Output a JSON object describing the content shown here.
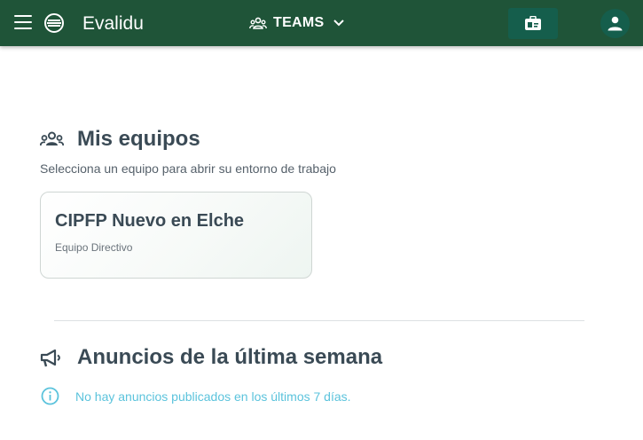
{
  "app": {
    "title": "Evalidu"
  },
  "header": {
    "teams_label": "TEAMS"
  },
  "teams_section": {
    "title": "Mis equipos",
    "subtitle": "Selecciona un equipo para abrir su entorno de trabajo",
    "teams": [
      {
        "name": "CIPFP Nuevo en Elche",
        "role": "Equipo Directivo"
      }
    ]
  },
  "announcements_section": {
    "title": "Anuncios de la última semana",
    "empty_message": "No hay anuncios publicados en los últimos 7 días."
  },
  "colors": {
    "header_bg": "#1f5438",
    "header_button_bg": "#155e4c",
    "heading_text": "#3a4a55",
    "info_text": "#5bc3dc"
  },
  "icons": {
    "menu": "menu-icon",
    "logo": "globe-logo-icon",
    "teams": "groups-icon",
    "dropdown": "chevron-down-icon",
    "card_button": "id-card-icon",
    "account": "person-icon",
    "announcements": "megaphone-icon",
    "info": "info-icon"
  }
}
